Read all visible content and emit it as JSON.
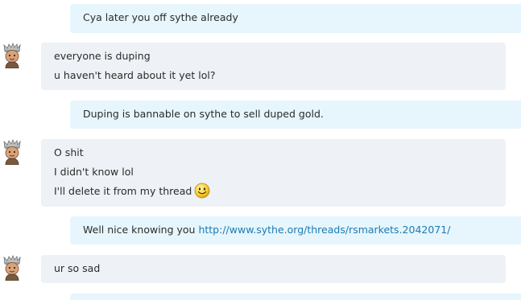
{
  "conversation": {
    "messages": [
      {
        "direction": "out",
        "lines": [
          "Cya later you off sythe already"
        ]
      },
      {
        "direction": "in",
        "avatar": "avatar-icon",
        "lines": [
          "everyone is duping",
          "u haven't heard about it yet lol?"
        ]
      },
      {
        "direction": "out",
        "lines": [
          "Duping is bannable on sythe to sell duped gold."
        ]
      },
      {
        "direction": "in",
        "avatar": "avatar-icon",
        "lines": [
          "O shit",
          "I didn't know lol",
          "I'll delete it from my thread"
        ],
        "emoji": "smile-emoji-icon"
      },
      {
        "direction": "out",
        "text_before_link": "Well nice knowing you ",
        "link": "http://www.sythe.org/threads/rsmarkets.2042071/"
      },
      {
        "direction": "in",
        "avatar": "avatar-icon",
        "lines": [
          "ur so sad"
        ]
      },
      {
        "direction": "out",
        "lines": []
      }
    ]
  },
  "colors": {
    "outgoing_bubble": "#e6f6fc",
    "incoming_bubble": "#eef1f5",
    "link": "#1d7ab5"
  }
}
